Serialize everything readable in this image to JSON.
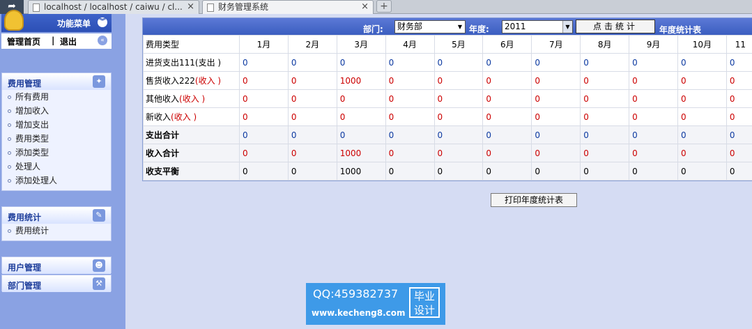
{
  "browser": {
    "tabs": [
      {
        "label": "localhost / localhost / caiwu / cl...",
        "active": false
      },
      {
        "label": "财务管理系统",
        "active": true
      }
    ],
    "close_glyph": "×",
    "new_tab_glyph": "+"
  },
  "sidebar": {
    "menu_title": "功能菜单",
    "home_label": "管理首页",
    "separator": "|",
    "logout_label": "退出",
    "sections": [
      {
        "title": "费用管理",
        "items": [
          "所有费用",
          "增加收入",
          "增加支出",
          "费用类型",
          "添加类型",
          "处理人",
          "添加处理人"
        ]
      },
      {
        "title": "费用统计",
        "items": [
          "费用统计"
        ]
      },
      {
        "title": "用户管理",
        "items": []
      },
      {
        "title": "部门管理",
        "items": []
      }
    ]
  },
  "filter": {
    "dept_label": "部门:",
    "dept_value": "财务部",
    "year_label": "年度:",
    "year_value": "2011",
    "stat_button": "点击统计",
    "annual_label": "年度统计表"
  },
  "table": {
    "header": [
      "费用类型",
      "1月",
      "2月",
      "3月",
      "4月",
      "5月",
      "6月",
      "7月",
      "8月",
      "9月",
      "10月",
      "11"
    ],
    "rows": [
      {
        "name": "进货支出111",
        "tag": "(支出 )",
        "tag_color": "black",
        "values": [
          "0",
          "0",
          "0",
          "0",
          "0",
          "0",
          "0",
          "0",
          "0",
          "0",
          "0"
        ],
        "value_color": "blue",
        "bold": false
      },
      {
        "name": "售货收入222",
        "tag": "(收入 )",
        "tag_color": "red",
        "values": [
          "0",
          "0",
          "1000",
          "0",
          "0",
          "0",
          "0",
          "0",
          "0",
          "0",
          "0"
        ],
        "value_color": "red",
        "bold": false
      },
      {
        "name": "其他收入",
        "tag": "(收入 )",
        "tag_color": "red",
        "values": [
          "0",
          "0",
          "0",
          "0",
          "0",
          "0",
          "0",
          "0",
          "0",
          "0",
          "0"
        ],
        "value_color": "red",
        "bold": false
      },
      {
        "name": "新收入",
        "tag": "(收入 )",
        "tag_color": "red",
        "values": [
          "0",
          "0",
          "0",
          "0",
          "0",
          "0",
          "0",
          "0",
          "0",
          "0",
          "0"
        ],
        "value_color": "red",
        "bold": false
      },
      {
        "name": "支出合计",
        "tag": "",
        "tag_color": "black",
        "values": [
          "0",
          "0",
          "0",
          "0",
          "0",
          "0",
          "0",
          "0",
          "0",
          "0",
          "0"
        ],
        "value_color": "blue",
        "bold": true
      },
      {
        "name": "收入合计",
        "tag": "",
        "tag_color": "black",
        "values": [
          "0",
          "0",
          "1000",
          "0",
          "0",
          "0",
          "0",
          "0",
          "0",
          "0",
          "0"
        ],
        "value_color": "red",
        "bold": true
      },
      {
        "name": "收支平衡",
        "tag": "",
        "tag_color": "black",
        "values": [
          "0",
          "0",
          "1000",
          "0",
          "0",
          "0",
          "0",
          "0",
          "0",
          "0",
          "0"
        ],
        "value_color": "black",
        "bold": true
      }
    ]
  },
  "print_button": "打印年度统计表",
  "watermark": {
    "qq": "QQ:459382737",
    "site": "www.kecheng8.com",
    "badge_line1": "毕业",
    "badge_line2": "设计"
  },
  "colors": {
    "accent": "#3b5ec0",
    "income": "#cc0000",
    "expense": "#0d3aa1",
    "background": "#d5dcf3"
  },
  "icons": [
    "back-arrow-icon",
    "page-icon",
    "close-icon",
    "new-tab-icon",
    "menu-logo-icon",
    "collapse-icon",
    "chart-icon",
    "edit-icon",
    "user-icon",
    "tools-icon",
    "dropdown-arrow-icon"
  ]
}
